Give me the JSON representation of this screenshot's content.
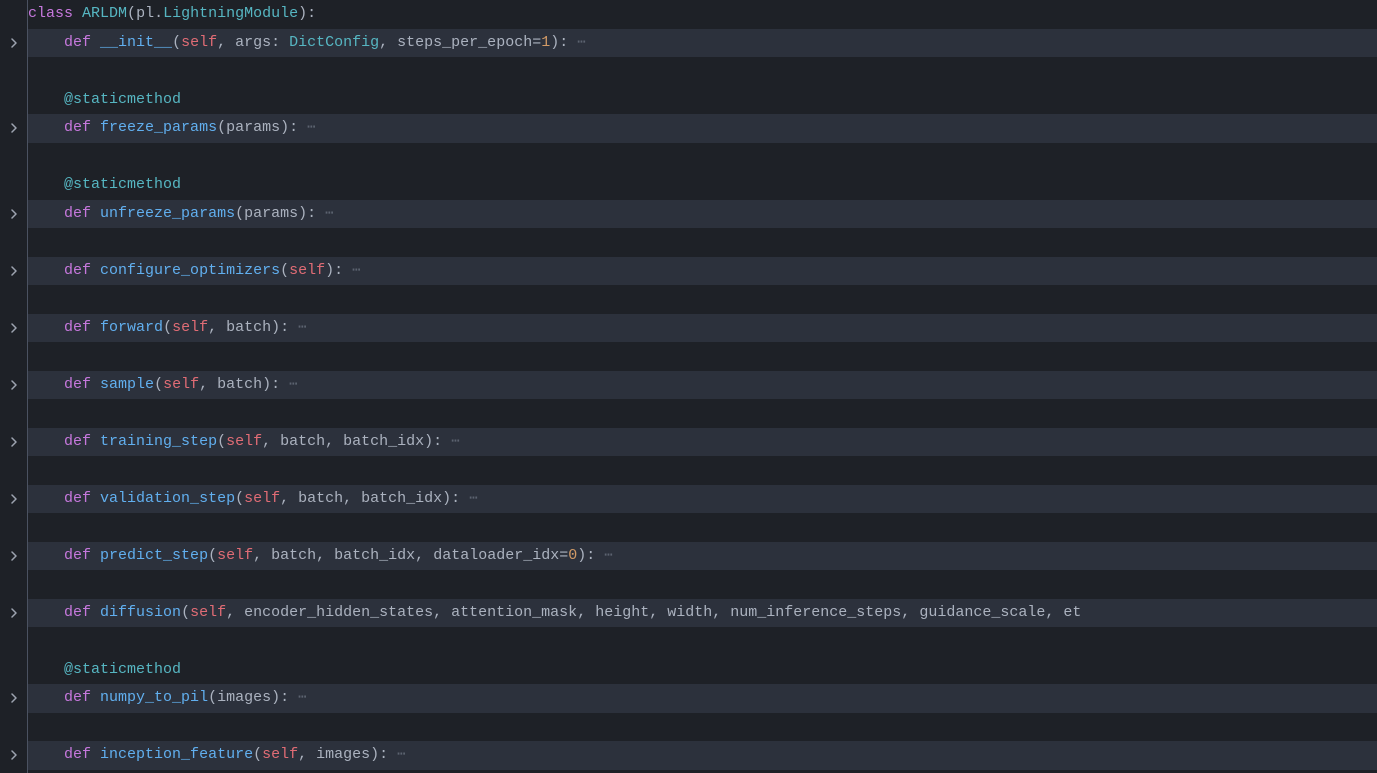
{
  "class_kw": "class",
  "class_name": "ARLDM",
  "class_base_mod": "pl",
  "class_base": "LightningModule",
  "def_kw": "def",
  "decorator": "@staticmethod",
  "ellipsis": "⋯",
  "methods": {
    "init": {
      "name": "__init__",
      "sig_open": "(",
      "self": "self",
      "c1": ", ",
      "p1": "args",
      "colon1": ": ",
      "t1": "DictConfig",
      "c2": ", ",
      "p2": "steps_per_epoch",
      "eq": "=",
      "v2": "1",
      "sig_close": "):"
    },
    "freeze": {
      "name": "freeze_params",
      "sig": "(",
      "p1": "params",
      "close": "):"
    },
    "unfreeze": {
      "name": "unfreeze_params",
      "sig": "(",
      "p1": "params",
      "close": "):"
    },
    "configure": {
      "name": "configure_optimizers",
      "sig": "(",
      "self": "self",
      "close": "):"
    },
    "forward": {
      "name": "forward",
      "sig": "(",
      "self": "self",
      "c1": ", ",
      "p1": "batch",
      "close": "):"
    },
    "sample": {
      "name": "sample",
      "sig": "(",
      "self": "self",
      "c1": ", ",
      "p1": "batch",
      "close": "):"
    },
    "training": {
      "name": "training_step",
      "sig": "(",
      "self": "self",
      "c1": ", ",
      "p1": "batch",
      "c2": ", ",
      "p2": "batch_idx",
      "close": "):"
    },
    "validation": {
      "name": "validation_step",
      "sig": "(",
      "self": "self",
      "c1": ", ",
      "p1": "batch",
      "c2": ", ",
      "p2": "batch_idx",
      "close": "):"
    },
    "predict": {
      "name": "predict_step",
      "sig": "(",
      "self": "self",
      "c1": ", ",
      "p1": "batch",
      "c2": ", ",
      "p2": "batch_idx",
      "c3": ", ",
      "p3": "dataloader_idx",
      "eq": "=",
      "v3": "0",
      "close": "):"
    },
    "diffusion": {
      "name": "diffusion",
      "sig": "(",
      "self": "self",
      "c1": ", ",
      "p1": "encoder_hidden_states",
      "c2": ", ",
      "p2": "attention_mask",
      "c3": ", ",
      "p3": "height",
      "c4": ", ",
      "p4": "width",
      "c5": ", ",
      "p5": "num_inference_steps",
      "c6": ", ",
      "p6": "guidance_scale",
      "c7": ", ",
      "p7": "et"
    },
    "numpy_to_pil": {
      "name": "numpy_to_pil",
      "sig": "(",
      "p1": "images",
      "close": "):"
    },
    "inception": {
      "name": "inception_feature",
      "sig": "(",
      "self": "self",
      "c1": ", ",
      "p1": "images",
      "close": "):"
    }
  }
}
